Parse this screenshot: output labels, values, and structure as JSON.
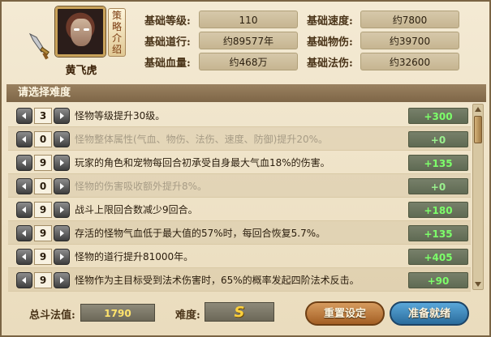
{
  "hero": {
    "name": "黄飞虎",
    "strategy_label": "策略介绍"
  },
  "stats": [
    {
      "label": "基础等级:",
      "value": "110"
    },
    {
      "label": "基础道行:",
      "value": "约89577年"
    },
    {
      "label": "基础血量:",
      "value": "约468万"
    },
    {
      "label": "基础速度:",
      "value": "约7800"
    },
    {
      "label": "基础物伤:",
      "value": "约39700"
    },
    {
      "label": "基础法伤:",
      "value": "约32600"
    }
  ],
  "section_title": "请选择难度",
  "rows": [
    {
      "level": "3",
      "text": "怪物等级提升30级。",
      "bonus": "+300",
      "dim": false
    },
    {
      "level": "0",
      "text": "怪物整体属性(气血、物伤、法伤、速度、防御)提升20%。",
      "bonus": "+0",
      "dim": true
    },
    {
      "level": "9",
      "text": "玩家的角色和宠物每回合初承受自身最大气血18%的伤害。",
      "bonus": "+135",
      "dim": false
    },
    {
      "level": "0",
      "text": "怪物的伤害吸收额外提升8%。",
      "bonus": "+0",
      "dim": true
    },
    {
      "level": "9",
      "text": "战斗上限回合数减少9回合。",
      "bonus": "+180",
      "dim": false
    },
    {
      "level": "9",
      "text": "存活的怪物气血低于最大值的57%时，每回合恢复5.7%。",
      "bonus": "+135",
      "dim": false
    },
    {
      "level": "9",
      "text": "怪物的道行提升81000年。",
      "bonus": "+405",
      "dim": false
    },
    {
      "level": "9",
      "text": "怪物作为主目标受到法术伤害时，65%的概率发起四阶法术反击。",
      "bonus": "+90",
      "dim": false
    }
  ],
  "footer": {
    "total_label": "总斗法值:",
    "total_value": "1790",
    "difficulty_label": "难度:",
    "difficulty_value": "S",
    "reset_label": "重置设定",
    "ready_label": "准备就绪"
  },
  "colors": {
    "bonus_text": "#7dff6a",
    "total_text": "#ffe36c",
    "reset_button": "#a35f24",
    "ready_button": "#2a6c9c"
  },
  "icons": {
    "weapon": "dagger-icon",
    "decrease": "arrow-left-icon",
    "increase": "arrow-right-icon"
  }
}
